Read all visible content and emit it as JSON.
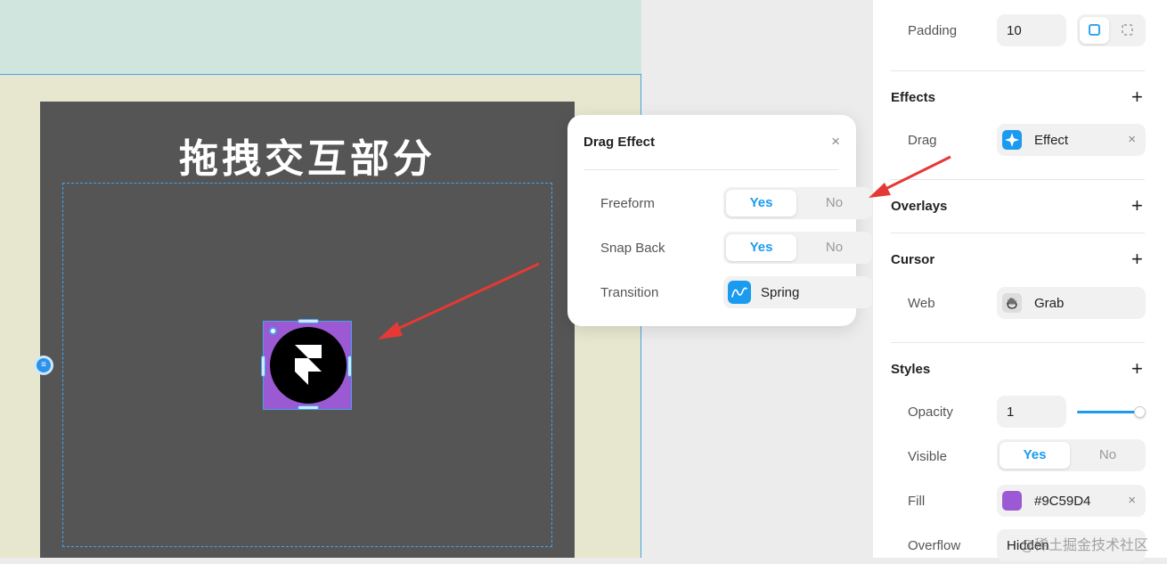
{
  "canvas": {
    "panel_title": "拖拽交互部分"
  },
  "popup": {
    "title": "Drag Effect",
    "close_icon": "×",
    "rows": [
      {
        "label": "Freeform",
        "yes": "Yes",
        "no": "No",
        "selected": "Yes"
      },
      {
        "label": "Snap Back",
        "yes": "Yes",
        "no": "No",
        "selected": "Yes"
      },
      {
        "label": "Transition",
        "value": "Spring",
        "icon": "spring-curve-icon"
      }
    ]
  },
  "props": {
    "padding": {
      "label": "Padding",
      "value": "10"
    },
    "effects": {
      "title": "Effects",
      "add": "+",
      "drag_label": "Drag",
      "drag_value": "Effect",
      "remove": "×"
    },
    "overlays": {
      "title": "Overlays",
      "add": "+"
    },
    "cursor": {
      "title": "Cursor",
      "add": "+",
      "web_label": "Web",
      "web_value": "Grab"
    },
    "styles": {
      "title": "Styles",
      "add": "+",
      "opacity_label": "Opacity",
      "opacity_value": "1",
      "visible_label": "Visible",
      "visible_yes": "Yes",
      "visible_no": "No",
      "fill_label": "Fill",
      "fill_value": "#9C59D4",
      "fill_remove": "×",
      "overflow_label": "Overflow",
      "overflow_value": "Hidden"
    }
  },
  "colors": {
    "accent": "#1a9bf0",
    "fill": "#9C59D4",
    "annotation": "#e53935"
  },
  "watermark": "@稀土掘金技术社区"
}
